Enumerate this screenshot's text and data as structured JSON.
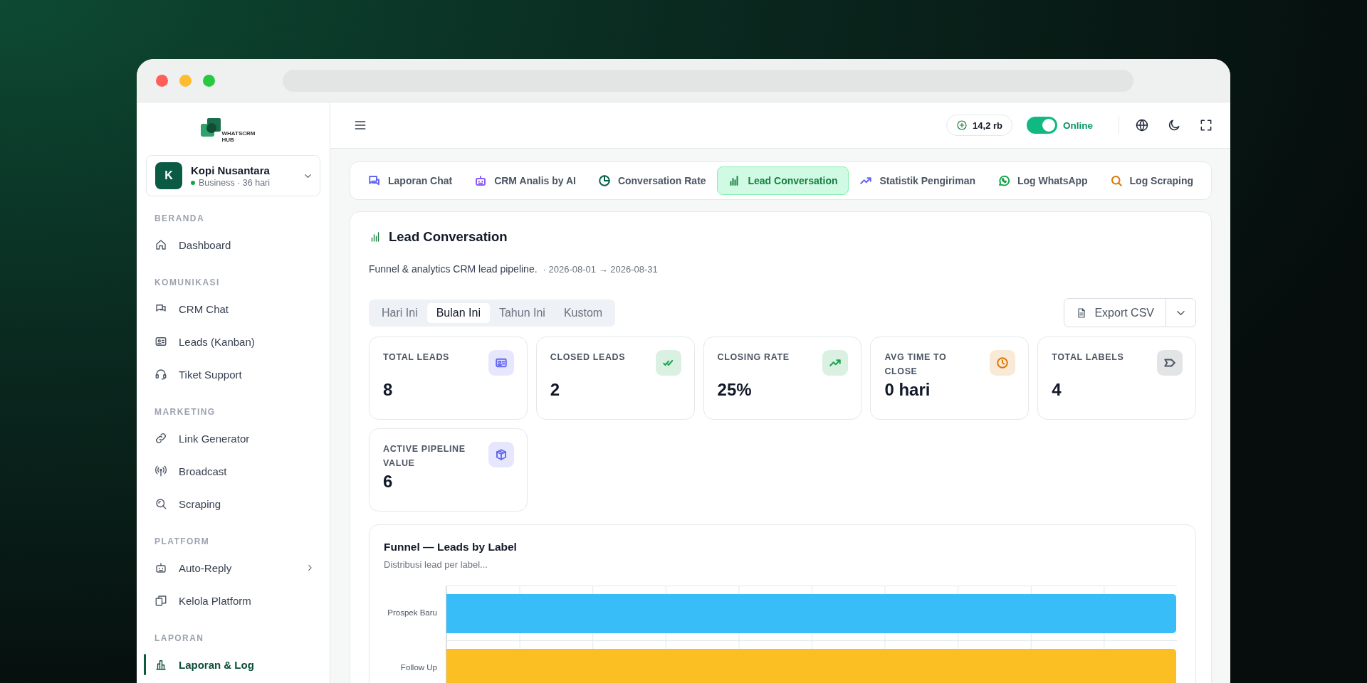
{
  "sidebar": {
    "logo": {
      "line_1": "WHATSCRM",
      "line_2": "HUB"
    },
    "account": {
      "initial": "K",
      "name": "Kopi Nusantara",
      "plan": "Business · 36 hari"
    },
    "sections": [
      {
        "title": "BERANDA",
        "items": [
          {
            "label": "Dashboard",
            "kind": "link",
            "selected": false
          }
        ]
      },
      {
        "title": "KOMUNIKASI",
        "items": [
          {
            "label": "CRM Chat",
            "kind": "link",
            "selected": false
          },
          {
            "label": "Leads (Kanban)",
            "kind": "link",
            "selected": false
          },
          {
            "label": "Tiket Support",
            "kind": "link",
            "selected": false
          }
        ]
      },
      {
        "title": "MARKETING",
        "items": [
          {
            "label": "Link Generator",
            "kind": "link",
            "selected": false
          },
          {
            "label": "Broadcast",
            "kind": "link",
            "selected": false
          },
          {
            "label": "Scraping",
            "kind": "link",
            "selected": false
          }
        ]
      },
      {
        "title": "PLATFORM",
        "items": [
          {
            "label": "Auto-Reply",
            "kind": "group",
            "selected": false
          },
          {
            "label": "Kelola Platform",
            "kind": "link",
            "selected": false
          }
        ]
      },
      {
        "title": "LAPORAN",
        "items": [
          {
            "label": "Laporan & Log",
            "kind": "link",
            "selected": true
          }
        ]
      }
    ]
  },
  "topbar": {
    "credits": "14,2 rb",
    "status": {
      "on": true,
      "label": "Online"
    }
  },
  "tabs": [
    {
      "label": "Laporan Chat",
      "selected": false,
      "color": "#6366f1"
    },
    {
      "label": "CRM Analis by AI",
      "selected": false,
      "color": "#8b5cf6"
    },
    {
      "label": "Conversation Rate",
      "selected": false,
      "color": "#065f46"
    },
    {
      "label": "Lead Conversation",
      "selected": true,
      "color": "#15803d"
    },
    {
      "label": "Statistik Pengiriman",
      "selected": false,
      "color": "#6366f1"
    },
    {
      "label": "Log WhatsApp",
      "selected": false,
      "color": "#16a34a"
    },
    {
      "label": "Log Scraping",
      "selected": false,
      "color": "#d97706"
    }
  ],
  "panel": {
    "title": "Lead Conversation",
    "description": "Funnel & analytics CRM lead pipeline.",
    "date_range": "· 2026-08-01 → 2026-08-31",
    "periods": [
      {
        "label": "Hari Ini",
        "selected": false
      },
      {
        "label": "Bulan Ini",
        "selected": true
      },
      {
        "label": "Tahun Ini",
        "selected": false
      },
      {
        "label": "Kustom",
        "selected": false
      }
    ],
    "export_label": "Export CSV",
    "stats": [
      {
        "label": "TOTAL LEADS",
        "value": "8",
        "color": "#6366f1"
      },
      {
        "label": "CLOSED LEADS",
        "value": "2",
        "color": "#16a34a"
      },
      {
        "label": "CLOSING RATE",
        "value": "25%",
        "color": "#16a34a"
      },
      {
        "label": "AVG TIME TO CLOSE",
        "value": "0 hari",
        "color": "#d97706"
      },
      {
        "label": "TOTAL LABELS",
        "value": "4",
        "color": "#4b5563"
      },
      {
        "label": "ACTIVE PIPELINE VALUE",
        "value": "6",
        "color": "#6366f1"
      }
    ],
    "chart": {
      "title": "Funnel — Leads by Label",
      "subtitle": "Distribusi lead per label...",
      "rows": [
        {
          "label": "Prospek Baru",
          "color": "#38bdf8"
        },
        {
          "label": "Follow Up",
          "color": "#fbbf24"
        }
      ]
    }
  }
}
